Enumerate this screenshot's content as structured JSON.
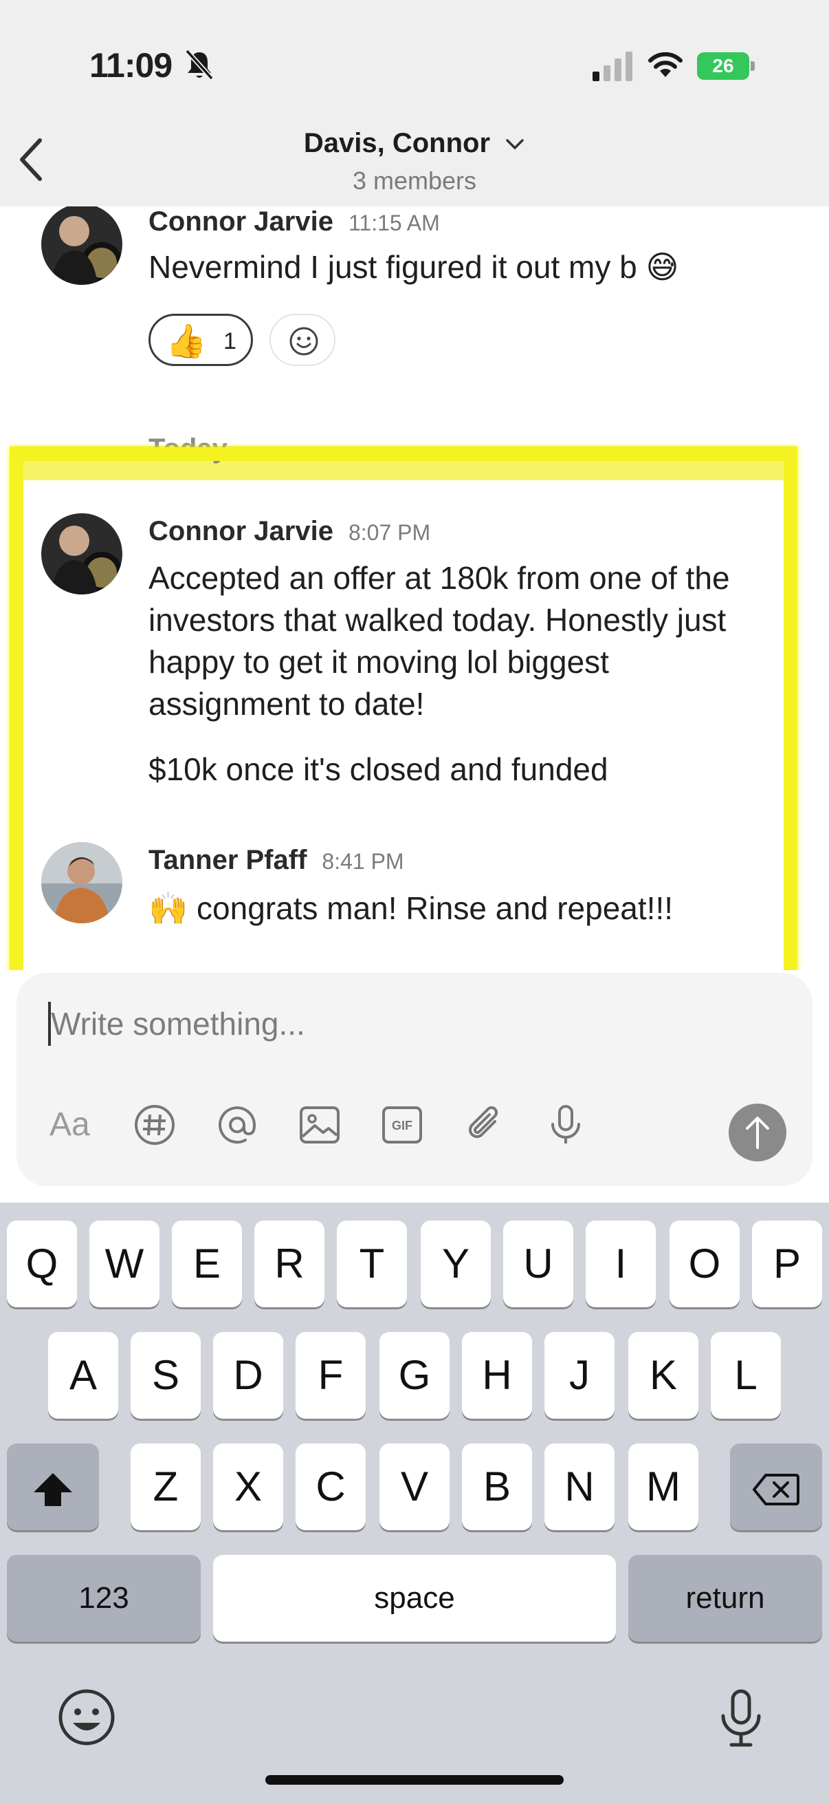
{
  "status_bar": {
    "time": "11:09",
    "battery": "26"
  },
  "header": {
    "title": "Davis, Connor",
    "subtitle": "3 members"
  },
  "messages": [
    {
      "sender": "Connor Jarvie",
      "time": "11:15 AM",
      "text": "Nevermind I just figured it out my b 😅",
      "reactions": [
        {
          "emoji": "👍",
          "count": "1"
        }
      ]
    },
    {
      "date_divider": "Today"
    },
    {
      "sender": "Connor Jarvie",
      "time": "8:07 PM",
      "paragraph1": "Accepted an offer at 180k from one of the investors that walked today. Honestly just happy to get it moving lol biggest assignment to date!",
      "paragraph2": "$10k once it's closed and funded"
    },
    {
      "sender": "Tanner Pfaff",
      "time": "8:41 PM",
      "text": "🙌 congrats man! Rinse and repeat!!!"
    }
  ],
  "composer": {
    "placeholder": "Write something...",
    "format_label": "Aa"
  },
  "keyboard": {
    "row1": [
      "Q",
      "W",
      "E",
      "R",
      "T",
      "Y",
      "U",
      "I",
      "O",
      "P"
    ],
    "row2": [
      "A",
      "S",
      "D",
      "F",
      "G",
      "H",
      "J",
      "K",
      "L"
    ],
    "row3": [
      "Z",
      "X",
      "C",
      "V",
      "B",
      "N",
      "M"
    ],
    "numbers": "123",
    "space": "space",
    "return": "return"
  },
  "colors": {
    "highlight": "#f5f222",
    "battery": "#34c759",
    "keyboard_bg": "#d1d4db"
  }
}
